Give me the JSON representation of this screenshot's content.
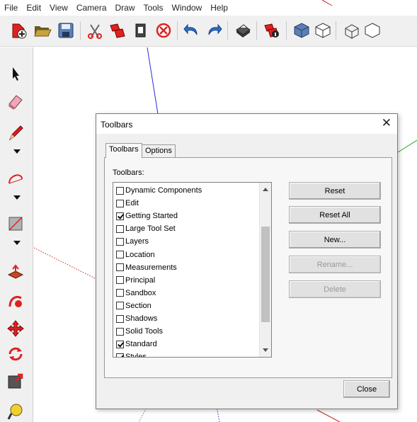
{
  "menu": [
    "File",
    "Edit",
    "View",
    "Camera",
    "Draw",
    "Tools",
    "Window",
    "Help"
  ],
  "main_toolbar": {
    "icons": [
      "new-model-icon",
      "open-folder-icon",
      "save-icon",
      "cut-icon",
      "copy-icon",
      "paste-icon",
      "erase-icon",
      "undo-icon",
      "redo-icon",
      "print-icon",
      "model-info-icon",
      "shaded-icon",
      "hidden-line-icon",
      "wireframe-icon",
      "xray-icon"
    ]
  },
  "left_tools": {
    "icons": [
      "select-icon",
      "eraser-icon",
      "line-pencil-icon",
      "arc-icon",
      "rectangle-icon",
      "push-pull-icon",
      "follow-me-icon",
      "move-icon",
      "rotate-icon",
      "scale-icon",
      "tape-measure-icon"
    ]
  },
  "dialog": {
    "title": "Toolbars",
    "close_glyph": "✕",
    "tabs": [
      {
        "label": "Toolbars",
        "active": true
      },
      {
        "label": "Options",
        "active": false
      }
    ],
    "list_label": "Toolbars:",
    "items": [
      {
        "label": "Dynamic Components",
        "checked": false
      },
      {
        "label": "Edit",
        "checked": false
      },
      {
        "label": "Getting Started",
        "checked": true
      },
      {
        "label": "Large Tool Set",
        "checked": false
      },
      {
        "label": "Layers",
        "checked": false
      },
      {
        "label": "Location",
        "checked": false
      },
      {
        "label": "Measurements",
        "checked": false
      },
      {
        "label": "Principal",
        "checked": false
      },
      {
        "label": "Sandbox",
        "checked": false
      },
      {
        "label": "Section",
        "checked": false
      },
      {
        "label": "Shadows",
        "checked": false
      },
      {
        "label": "Solid Tools",
        "checked": false
      },
      {
        "label": "Standard",
        "checked": true
      },
      {
        "label": "Styles",
        "checked": true
      }
    ],
    "buttons": [
      {
        "label": "Reset",
        "enabled": true
      },
      {
        "label": "Reset All",
        "enabled": true
      },
      {
        "label": "New...",
        "enabled": true
      },
      {
        "label": "Rename...",
        "enabled": false
      },
      {
        "label": "Delete",
        "enabled": false
      }
    ],
    "close_label": "Close"
  }
}
